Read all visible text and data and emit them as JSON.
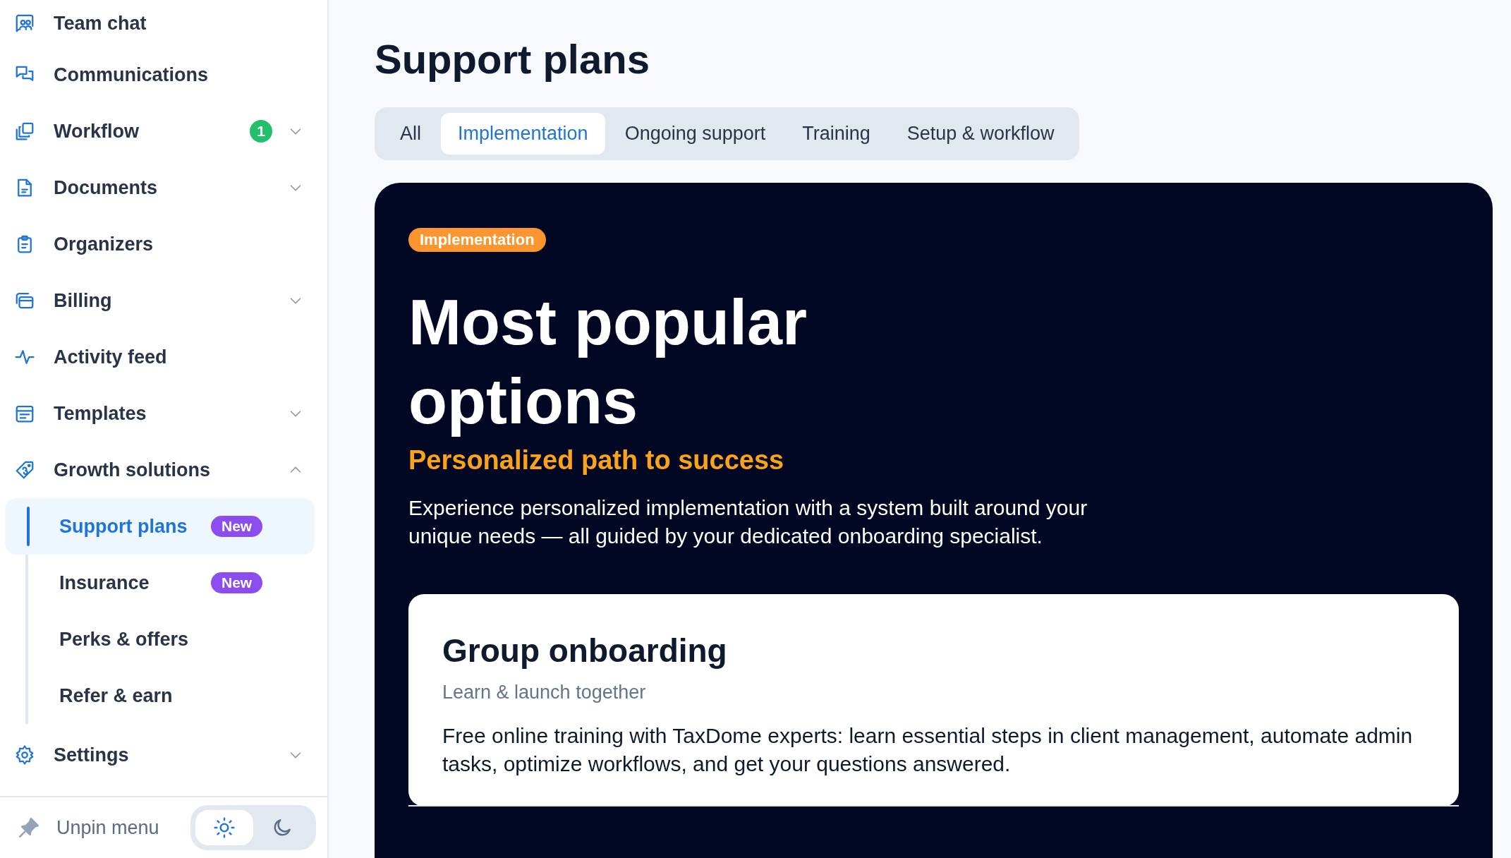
{
  "sidebar": {
    "items": [
      {
        "label": "Team chat"
      },
      {
        "label": "Communications"
      },
      {
        "label": "Workflow",
        "badge": "1",
        "expanded": false
      },
      {
        "label": "Documents",
        "expanded": false
      },
      {
        "label": "Organizers"
      },
      {
        "label": "Billing",
        "expanded": false
      },
      {
        "label": "Activity feed"
      },
      {
        "label": "Templates",
        "expanded": false
      },
      {
        "label": "Growth solutions",
        "expanded": true,
        "children": [
          {
            "label": "Support plans",
            "badge": "New",
            "selected": true
          },
          {
            "label": "Insurance",
            "badge": "New",
            "selected": false
          },
          {
            "label": "Perks & offers",
            "selected": false
          },
          {
            "label": "Refer & earn",
            "selected": false
          }
        ]
      },
      {
        "label": "Settings",
        "expanded": false
      }
    ],
    "footer": {
      "unpin": "Unpin menu",
      "theme": [
        {
          "selected": true
        },
        {
          "selected": false
        }
      ]
    }
  },
  "page": {
    "title": "Support plans",
    "tabs": [
      {
        "label": "All",
        "selected": false
      },
      {
        "label": "Implementation",
        "selected": true
      },
      {
        "label": "Ongoing support",
        "selected": false
      },
      {
        "label": "Training",
        "selected": false
      },
      {
        "label": "Setup & workflow",
        "selected": false
      }
    ],
    "hero": {
      "tag": "Implementation",
      "heading": "Most popular options",
      "subtitle": "Personalized path to success",
      "description": "Experience personalized implementation with a system built around your unique needs — all guided by your dedicated onboarding specialist.",
      "card": {
        "title": "Group onboarding",
        "subtitle": "Learn & launch together",
        "body": "Free online training with TaxDome experts: learn essential steps in client management, automate admin tasks, optimize workflows, and get your questions answered."
      }
    }
  }
}
